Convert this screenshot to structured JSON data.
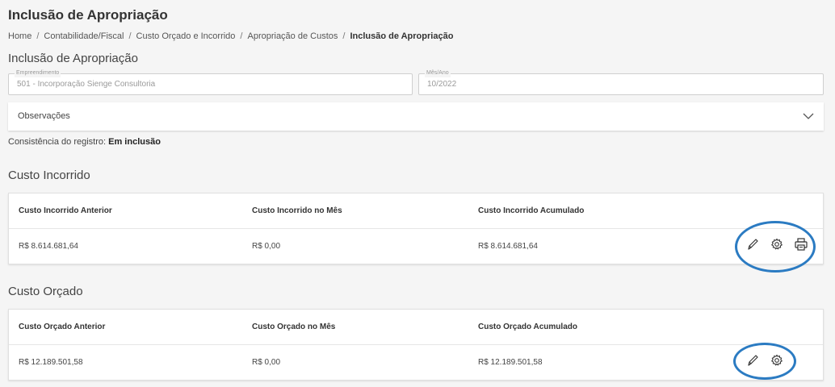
{
  "page": {
    "title": "Inclusão de Apropriação"
  },
  "breadcrumb": [
    "Home",
    "Contabilidade/Fiscal",
    "Custo Orçado e Incorrido",
    "Apropriação de Custos",
    "Inclusão de Apropriação"
  ],
  "form": {
    "section_title": "Inclusão de Apropriação",
    "empreendimento": {
      "label": "Empreendimento",
      "value": "501 - Incorporação Sienge Consultoria"
    },
    "mes_ano": {
      "label": "Mês/Ano",
      "value": "10/2022"
    }
  },
  "observacoes": {
    "label": "Observações"
  },
  "consistencia": {
    "label": "Consistência do registro:",
    "value": "Em inclusão"
  },
  "custo_incorrido": {
    "title": "Custo Incorrido",
    "headers": [
      "Custo Incorrido Anterior",
      "Custo Incorrido no Mês",
      "Custo Incorrido Acumulado"
    ],
    "values": [
      "R$ 8.614.681,64",
      "R$ 0,00",
      "R$ 8.614.681,64"
    ],
    "actions": [
      "pencil-icon",
      "gear-icon",
      "printer-icon"
    ]
  },
  "custo_orcado": {
    "title": "Custo Orçado",
    "headers": [
      "Custo Orçado Anterior",
      "Custo Orçado no Mês",
      "Custo Orçado Acumulado"
    ],
    "values": [
      "R$ 12.189.501,58",
      "R$ 0,00",
      "R$ 12.189.501,58"
    ],
    "actions": [
      "pencil-icon",
      "gear-icon"
    ]
  },
  "colors": {
    "highlight_circle": "#2b7bc2",
    "background": "#f5f5f5"
  }
}
